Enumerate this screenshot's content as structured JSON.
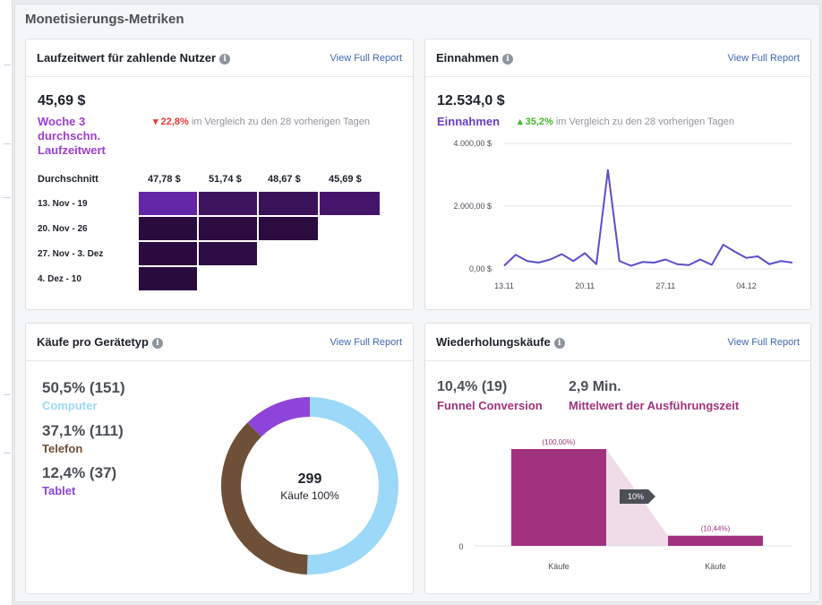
{
  "section_title": "Monetisierungs-Metriken",
  "info_glyph": "i",
  "ltv_card": {
    "title": "Laufzeitwert für zahlende Nutzer",
    "report_link": "View Full Report",
    "value": "45,69 $",
    "label_lines": [
      "Woche 3",
      "durchschn.",
      "Laufzeitwert"
    ],
    "change": "22,8%",
    "change_direction": "down",
    "compare_text": "im Vergleich zu den 28 vorherigen Tagen",
    "cohort": {
      "avg_label": "Durchschnitt",
      "column_heads": [
        "47,78 $",
        "51,74 $",
        "48,67 $",
        "45,69 $"
      ],
      "rows": [
        {
          "label": "13. Nov - 19",
          "cells": 4
        },
        {
          "label": "20. Nov - 26",
          "cells": 3
        },
        {
          "label": "27. Nov - 3. Dez",
          "cells": 2
        },
        {
          "label": "4. Dez - 10",
          "cells": 1
        }
      ]
    }
  },
  "revenue_card": {
    "title": "Einnahmen",
    "report_link": "View Full Report",
    "value": "12.534,0 $",
    "label": "Einnahmen",
    "change": "35,2%",
    "change_direction": "up",
    "compare_text": "im Vergleich zu den 28 vorherigen Tagen"
  },
  "device_card": {
    "title": "Käufe pro Gerätetyp",
    "report_link": "View Full Report",
    "items": [
      {
        "value": "50,5% (151)",
        "name": "Computer",
        "color": "#9cd8f7"
      },
      {
        "value": "37,1% (111)",
        "name": "Telefon",
        "color": "#6e5038"
      },
      {
        "value": "12,4% (37)",
        "name": "Tablet",
        "color": "#8e44d8"
      }
    ],
    "center_value": "299",
    "center_label": "Käufe 100%"
  },
  "repeat_card": {
    "title": "Wiederholungskäufe",
    "report_link": "View Full Report",
    "metric1_value": "10,4% (19)",
    "metric1_label": "Funnel Conversion",
    "metric2_value": "2,9 Min.",
    "metric2_label": "Mittelwert der Ausführungszeit",
    "conversion_badge": "10%"
  },
  "colors": {
    "purple_label": "#9b3fd1",
    "revenue_label": "#6a3fc4",
    "magenta": "#a0327e",
    "cohort_top": "#5a1f8c",
    "cohort_dark": "#2a0b3d"
  },
  "chart_data": [
    {
      "type": "line",
      "ylim": [
        0,
        4000
      ],
      "y_ticks": [
        "4.000,00 $",
        "2.000,00 $",
        "0,00 $"
      ],
      "x_ticks": [
        "13.11",
        "20.11",
        "27.11",
        "04.12"
      ],
      "series": [
        {
          "values": [
            100,
            450,
            250,
            200,
            300,
            470,
            250,
            500,
            150,
            3150,
            250,
            100,
            220,
            200,
            300,
            150,
            120,
            300,
            130,
            770,
            550,
            350,
            400,
            150,
            250,
            200
          ]
        }
      ]
    },
    {
      "type": "pie",
      "categories": [
        "Computer",
        "Telefon",
        "Tablet"
      ],
      "values": [
        50.5,
        37.1,
        12.4
      ],
      "counts": [
        151,
        111,
        37
      ]
    },
    {
      "type": "bar",
      "categories": [
        "Käufe",
        "Käufe"
      ],
      "values": [
        100,
        10.44
      ],
      "data_labels": [
        "(100,00%)",
        "(10,44%)"
      ],
      "y_ticks": [
        "0"
      ]
    }
  ]
}
